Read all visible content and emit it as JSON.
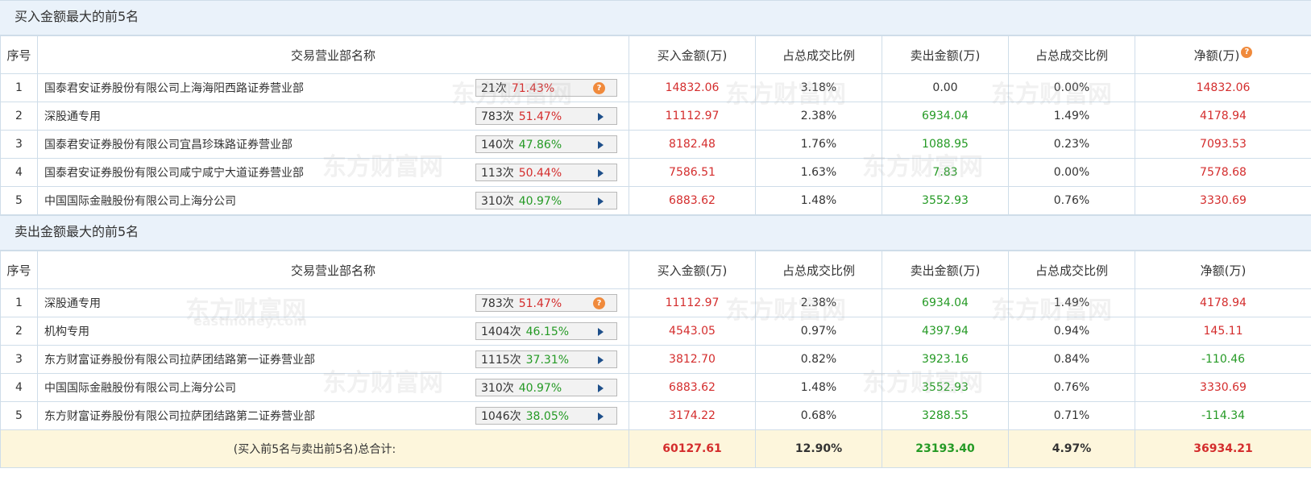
{
  "buy_section": {
    "title": "买入金额最大的前5名",
    "headers": [
      "序号",
      "交易营业部名称",
      "买入金额(万)",
      "占总成交比例",
      "卖出金额(万)",
      "占总成交比例",
      "净额(万)"
    ],
    "rows": [
      {
        "idx": "1",
        "name": "国泰君安证券股份有限公司上海海阳西路证券营业部",
        "count": "21次",
        "pct": "71.43%",
        "pct_color": "red",
        "chip_icon": "question",
        "buy": "14832.06",
        "buy_ratio": "3.18%",
        "sell": "0.00",
        "sell_color": "plain",
        "sell_ratio": "0.00%",
        "net": "14832.06",
        "net_color": "red"
      },
      {
        "idx": "2",
        "name": "深股通专用",
        "count": "783次",
        "pct": "51.47%",
        "pct_color": "red",
        "chip_icon": "arrow",
        "buy": "11112.97",
        "buy_ratio": "2.38%",
        "sell": "6934.04",
        "sell_color": "green",
        "sell_ratio": "1.49%",
        "net": "4178.94",
        "net_color": "red"
      },
      {
        "idx": "3",
        "name": "国泰君安证券股份有限公司宜昌珍珠路证券营业部",
        "count": "140次",
        "pct": "47.86%",
        "pct_color": "green",
        "chip_icon": "arrow",
        "buy": "8182.48",
        "buy_ratio": "1.76%",
        "sell": "1088.95",
        "sell_color": "green",
        "sell_ratio": "0.23%",
        "net": "7093.53",
        "net_color": "red"
      },
      {
        "idx": "4",
        "name": "国泰君安证券股份有限公司咸宁咸宁大道证券营业部",
        "count": "113次",
        "pct": "50.44%",
        "pct_color": "red",
        "chip_icon": "arrow",
        "buy": "7586.51",
        "buy_ratio": "1.63%",
        "sell": "7.83",
        "sell_color": "green",
        "sell_ratio": "0.00%",
        "net": "7578.68",
        "net_color": "red"
      },
      {
        "idx": "5",
        "name": "中国国际金融股份有限公司上海分公司",
        "count": "310次",
        "pct": "40.97%",
        "pct_color": "green",
        "chip_icon": "arrow",
        "buy": "6883.62",
        "buy_ratio": "1.48%",
        "sell": "3552.93",
        "sell_color": "green",
        "sell_ratio": "0.76%",
        "net": "3330.69",
        "net_color": "red"
      }
    ]
  },
  "sell_section": {
    "title": "卖出金额最大的前5名",
    "headers": [
      "序号",
      "交易营业部名称",
      "买入金额(万)",
      "占总成交比例",
      "卖出金额(万)",
      "占总成交比例",
      "净额(万)"
    ],
    "rows": [
      {
        "idx": "1",
        "name": "深股通专用",
        "count": "783次",
        "pct": "51.47%",
        "pct_color": "red",
        "chip_icon": "question",
        "buy": "11112.97",
        "buy_ratio": "2.38%",
        "sell": "6934.04",
        "sell_color": "green",
        "sell_ratio": "1.49%",
        "net": "4178.94",
        "net_color": "red"
      },
      {
        "idx": "2",
        "name": "机构专用",
        "count": "1404次",
        "pct": "46.15%",
        "pct_color": "green",
        "chip_icon": "arrow",
        "buy": "4543.05",
        "buy_ratio": "0.97%",
        "sell": "4397.94",
        "sell_color": "green",
        "sell_ratio": "0.94%",
        "net": "145.11",
        "net_color": "red"
      },
      {
        "idx": "3",
        "name": "东方财富证券股份有限公司拉萨团结路第一证券营业部",
        "count": "1115次",
        "pct": "37.31%",
        "pct_color": "green",
        "chip_icon": "arrow",
        "buy": "3812.70",
        "buy_ratio": "0.82%",
        "sell": "3923.16",
        "sell_color": "green",
        "sell_ratio": "0.84%",
        "net": "-110.46",
        "net_color": "green"
      },
      {
        "idx": "4",
        "name": "中国国际金融股份有限公司上海分公司",
        "count": "310次",
        "pct": "40.97%",
        "pct_color": "green",
        "chip_icon": "arrow",
        "buy": "6883.62",
        "buy_ratio": "1.48%",
        "sell": "3552.93",
        "sell_color": "green",
        "sell_ratio": "0.76%",
        "net": "3330.69",
        "net_color": "red"
      },
      {
        "idx": "5",
        "name": "东方财富证券股份有限公司拉萨团结路第二证券营业部",
        "count": "1046次",
        "pct": "38.05%",
        "pct_color": "green",
        "chip_icon": "arrow",
        "buy": "3174.22",
        "buy_ratio": "0.68%",
        "sell": "3288.55",
        "sell_color": "green",
        "sell_ratio": "0.71%",
        "net": "-114.34",
        "net_color": "green"
      }
    ],
    "total": {
      "label": "(买入前5名与卖出前5名)总合计:",
      "buy": "60127.61",
      "buy_ratio": "12.90%",
      "sell": "23193.40",
      "sell_ratio": "4.97%",
      "net": "36934.21"
    }
  },
  "icons": {
    "question": "question-icon",
    "arrow": "play-arrow-icon"
  },
  "colors": {
    "red": "#d42d2d",
    "green": "#259a25",
    "header_bg": "#eaf2fa",
    "total_bg": "#fdf6dc",
    "question_icon": "#f08a3c"
  },
  "watermark": [
    "东方财富网",
    "eastmoney.com"
  ]
}
